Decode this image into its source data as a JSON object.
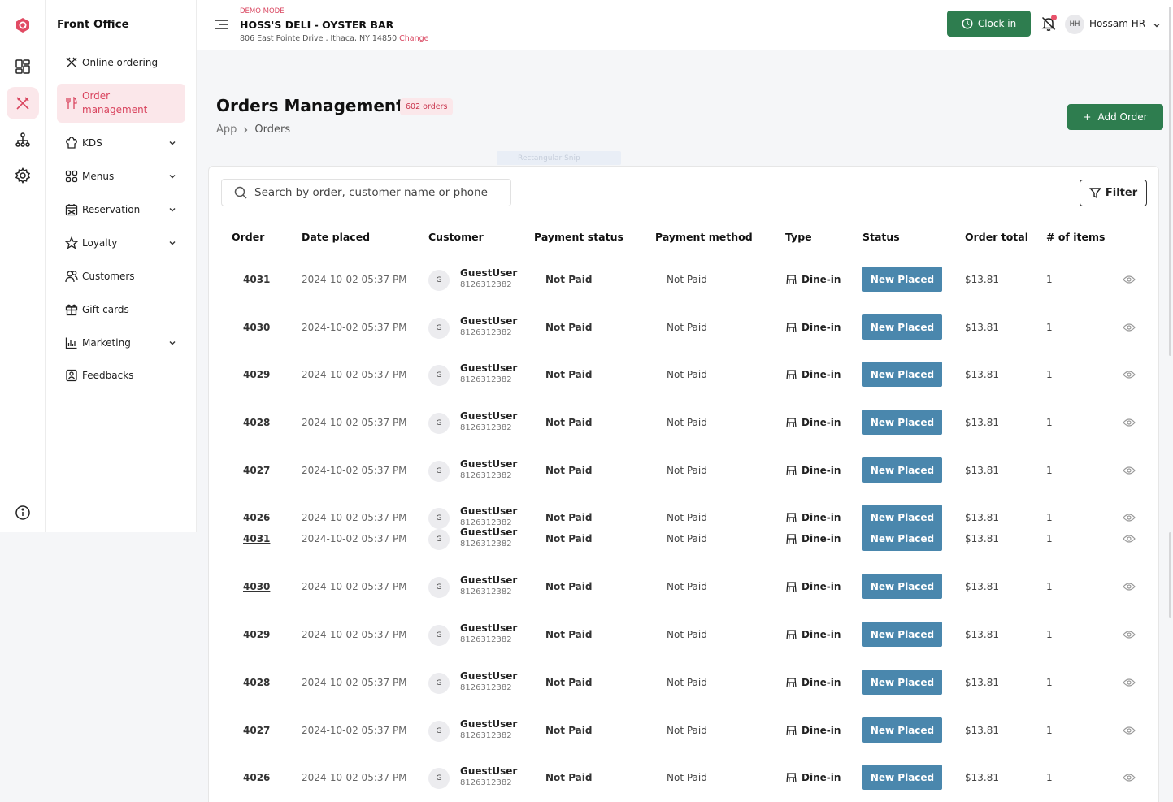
{
  "brand": {
    "title": "Front Office"
  },
  "rail": {
    "icons": [
      "logo-icon",
      "dashboard-icon",
      "order-icon",
      "sitemap-icon",
      "settings-icon",
      "info-icon"
    ]
  },
  "sidebar": {
    "items": [
      {
        "label": "Online ordering",
        "icon": "utensils-cross-icon",
        "expandable": false,
        "active": false
      },
      {
        "label": "Order management",
        "icon": "fork-knife-icon",
        "expandable": false,
        "active": true
      },
      {
        "label": "KDS",
        "icon": "chef-hat-icon",
        "expandable": true,
        "active": false
      },
      {
        "label": "Menus",
        "icon": "grid-icon",
        "expandable": true,
        "active": false
      },
      {
        "label": "Reservation",
        "icon": "calendar-icon",
        "expandable": true,
        "active": false
      },
      {
        "label": "Loyalty",
        "icon": "star-icon",
        "expandable": true,
        "active": false
      },
      {
        "label": "Customers",
        "icon": "users-icon",
        "expandable": false,
        "active": false
      },
      {
        "label": "Gift cards",
        "icon": "gift-icon",
        "expandable": false,
        "active": false
      },
      {
        "label": "Marketing",
        "icon": "bar-chart-icon",
        "expandable": true,
        "active": false
      },
      {
        "label": "Feedbacks",
        "icon": "feedback-icon",
        "expandable": false,
        "active": false
      }
    ]
  },
  "header": {
    "mode": "DEMO MODE",
    "restaurant": "HOSS'S DELI - OYSTER BAR",
    "address": "806 East Pointe Drive , Ithaca, NY 14850",
    "change_label": "Change",
    "clock_label": "Clock in",
    "user_initials": "HH",
    "user_name": "Hossam HR"
  },
  "page": {
    "title": "Orders Management",
    "count": "602 orders",
    "breadcrumb": [
      "App",
      "Orders"
    ],
    "add_label": "Add Order",
    "ghost_label": "Rectangular Snip"
  },
  "search": {
    "placeholder": "Search by order, customer name or phone"
  },
  "filter_label": "Filter",
  "table": {
    "columns": [
      "Order",
      "Date placed",
      "Customer",
      "Payment status",
      "Payment method",
      "Type",
      "Status",
      "Order total",
      "# of items"
    ],
    "rows": [
      {
        "order": "4031",
        "date": "2024-10-02 05:37 PM",
        "initial": "G",
        "customer": "GuestUser",
        "phone": "8126312382",
        "payment_status": "Not Paid",
        "payment_method": "Not Paid",
        "type": "Dine-in",
        "status": "New Placed",
        "total": "$13.81",
        "items": "1"
      },
      {
        "order": "4030",
        "date": "2024-10-02 05:37 PM",
        "initial": "G",
        "customer": "GuestUser",
        "phone": "8126312382",
        "payment_status": "Not Paid",
        "payment_method": "Not Paid",
        "type": "Dine-in",
        "status": "New Placed",
        "total": "$13.81",
        "items": "1"
      },
      {
        "order": "4029",
        "date": "2024-10-02 05:37 PM",
        "initial": "G",
        "customer": "GuestUser",
        "phone": "8126312382",
        "payment_status": "Not Paid",
        "payment_method": "Not Paid",
        "type": "Dine-in",
        "status": "New Placed",
        "total": "$13.81",
        "items": "1"
      },
      {
        "order": "4028",
        "date": "2024-10-02 05:37 PM",
        "initial": "G",
        "customer": "GuestUser",
        "phone": "8126312382",
        "payment_status": "Not Paid",
        "payment_method": "Not Paid",
        "type": "Dine-in",
        "status": "New Placed",
        "total": "$13.81",
        "items": "1"
      },
      {
        "order": "4027",
        "date": "2024-10-02 05:37 PM",
        "initial": "G",
        "customer": "GuestUser",
        "phone": "8126312382",
        "payment_status": "Not Paid",
        "payment_method": "Not Paid",
        "type": "Dine-in",
        "status": "New Placed",
        "total": "$13.81",
        "items": "1"
      },
      {
        "order": "4026",
        "date": "2024-10-02 05:37 PM",
        "initial": "G",
        "customer": "GuestUser",
        "phone": "8126312382",
        "payment_status": "Not Paid",
        "payment_method": "Not Paid",
        "type": "Dine-in",
        "status": "New Placed",
        "total": "$13.81",
        "items": "1"
      },
      {
        "order": "4031",
        "date": "2024-10-02 05:37 PM",
        "initial": "G",
        "customer": "GuestUser",
        "phone": "8126312382",
        "payment_status": "Not Paid",
        "payment_method": "Not Paid",
        "type": "Dine-in",
        "status": "New Placed",
        "total": "$13.81",
        "items": "1"
      },
      {
        "order": "4030",
        "date": "2024-10-02 05:37 PM",
        "initial": "G",
        "customer": "GuestUser",
        "phone": "8126312382",
        "payment_status": "Not Paid",
        "payment_method": "Not Paid",
        "type": "Dine-in",
        "status": "New Placed",
        "total": "$13.81",
        "items": "1"
      },
      {
        "order": "4029",
        "date": "2024-10-02 05:37 PM",
        "initial": "G",
        "customer": "GuestUser",
        "phone": "8126312382",
        "payment_status": "Not Paid",
        "payment_method": "Not Paid",
        "type": "Dine-in",
        "status": "New Placed",
        "total": "$13.81",
        "items": "1"
      },
      {
        "order": "4028",
        "date": "2024-10-02 05:37 PM",
        "initial": "G",
        "customer": "GuestUser",
        "phone": "8126312382",
        "payment_status": "Not Paid",
        "payment_method": "Not Paid",
        "type": "Dine-in",
        "status": "New Placed",
        "total": "$13.81",
        "items": "1"
      },
      {
        "order": "4027",
        "date": "2024-10-02 05:37 PM",
        "initial": "G",
        "customer": "GuestUser",
        "phone": "8126312382",
        "payment_status": "Not Paid",
        "payment_method": "Not Paid",
        "type": "Dine-in",
        "status": "New Placed",
        "total": "$13.81",
        "items": "1"
      },
      {
        "order": "4026",
        "date": "2024-10-02 05:37 PM",
        "initial": "G",
        "customer": "GuestUser",
        "phone": "8126312382",
        "payment_status": "Not Paid",
        "payment_method": "Not Paid",
        "type": "Dine-in",
        "status": "New Placed",
        "total": "$13.81",
        "items": "1"
      }
    ]
  },
  "colors": {
    "accent": "#d9455f",
    "primary_green": "#2e7d4f",
    "status_blue": "#4a87ad"
  }
}
